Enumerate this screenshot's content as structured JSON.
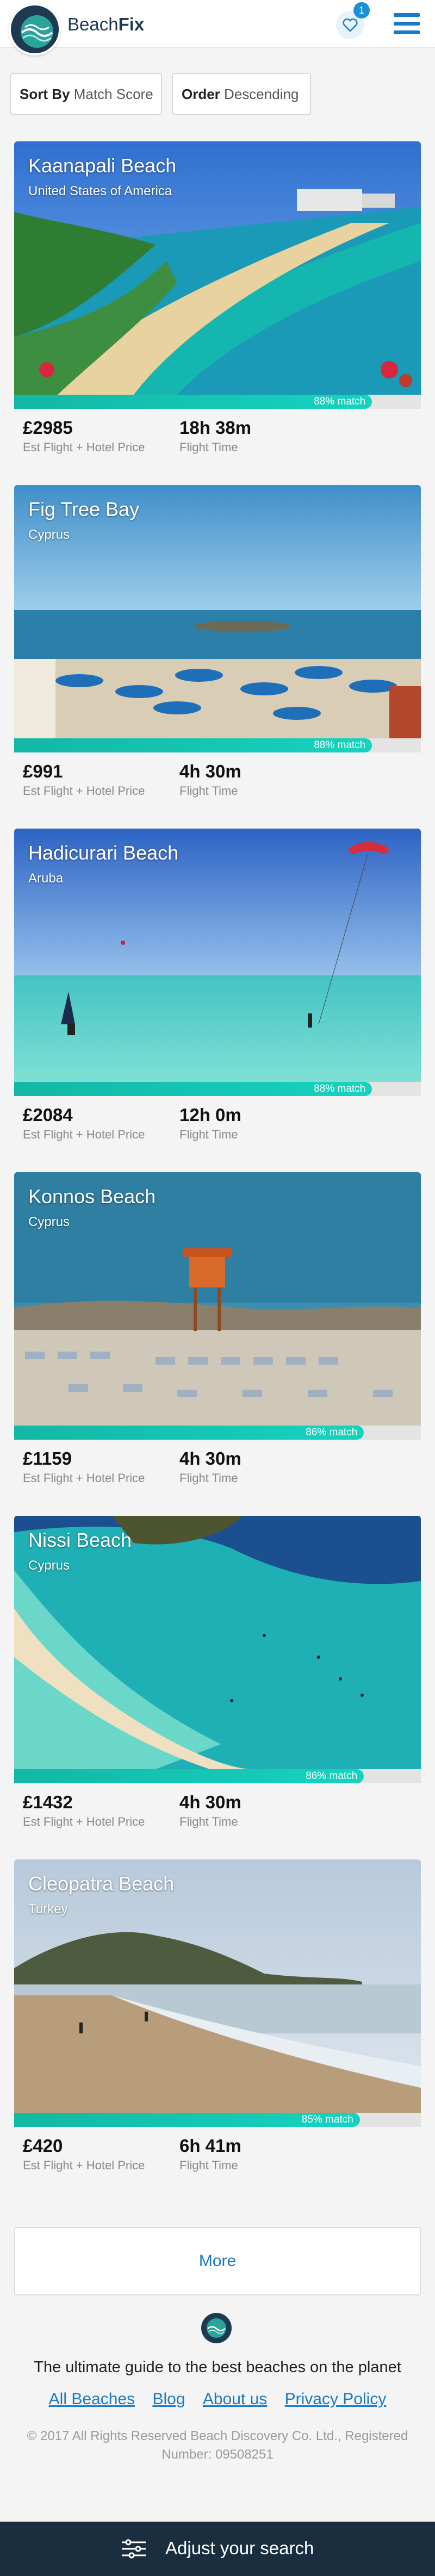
{
  "header": {
    "brand_light": "Beach",
    "brand_bold": "Fix",
    "favorites_count": "1",
    "logo_icon": "wave-globe-icon",
    "favorites_icon": "heart-icon",
    "menu_icon": "hamburger-menu-icon"
  },
  "sort": {
    "sort_key": "Sort By",
    "sort_value": "Match Score",
    "order_key": "Order",
    "order_value": "Descending"
  },
  "beaches": [
    {
      "name": "Kaanapali Beach",
      "country": "United States of America",
      "price": "£2985",
      "price_label": "Est Flight + Hotel Price",
      "flight_time": "18h 38m",
      "flight_label": "Flight Time",
      "match_label": "88% match",
      "match": 0.88
    },
    {
      "name": "Fig Tree Bay",
      "country": "Cyprus",
      "price": "£991",
      "price_label": "Est Flight + Hotel Price",
      "flight_time": "4h 30m",
      "flight_label": "Flight Time",
      "match_label": "88% match",
      "match": 0.88
    },
    {
      "name": "Hadicurari Beach",
      "country": "Aruba",
      "price": "£2084",
      "price_label": "Est Flight + Hotel Price",
      "flight_time": "12h 0m",
      "flight_label": "Flight Time",
      "match_label": "88% match",
      "match": 0.88
    },
    {
      "name": "Konnos Beach",
      "country": "Cyprus",
      "price": "£1159",
      "price_label": "Est Flight + Hotel Price",
      "flight_time": "4h 30m",
      "flight_label": "Flight Time",
      "match_label": "86% match",
      "match": 0.86
    },
    {
      "name": "Nissi Beach",
      "country": "Cyprus",
      "price": "£1432",
      "price_label": "Est Flight + Hotel Price",
      "flight_time": "4h 30m",
      "flight_label": "Flight Time",
      "match_label": "86% match",
      "match": 0.86
    },
    {
      "name": "Cleopatra Beach",
      "country": "Turkey",
      "price": "£420",
      "price_label": "Est Flight + Hotel Price",
      "flight_time": "6h 41m",
      "flight_label": "Flight Time",
      "match_label": "85% match",
      "match": 0.85
    }
  ],
  "more_label": "More",
  "footer": {
    "tagline": "The ultimate guide to the best beaches on the planet",
    "links": [
      "All Beaches",
      "Blog",
      "About us",
      "Privacy Policy"
    ],
    "copyright": "© 2017 All Rights Reserved Beach Discovery Co. Ltd., Registered Number: 09508251"
  },
  "adjust_bar": {
    "label": "Adjust your search",
    "icon": "sliders-icon"
  },
  "colors": {
    "brand_navy": "#1d3a52",
    "accent_blue": "#1a7ac7",
    "match_teal": "#14b7a5",
    "bottom_bar": "#1b2e3f"
  }
}
